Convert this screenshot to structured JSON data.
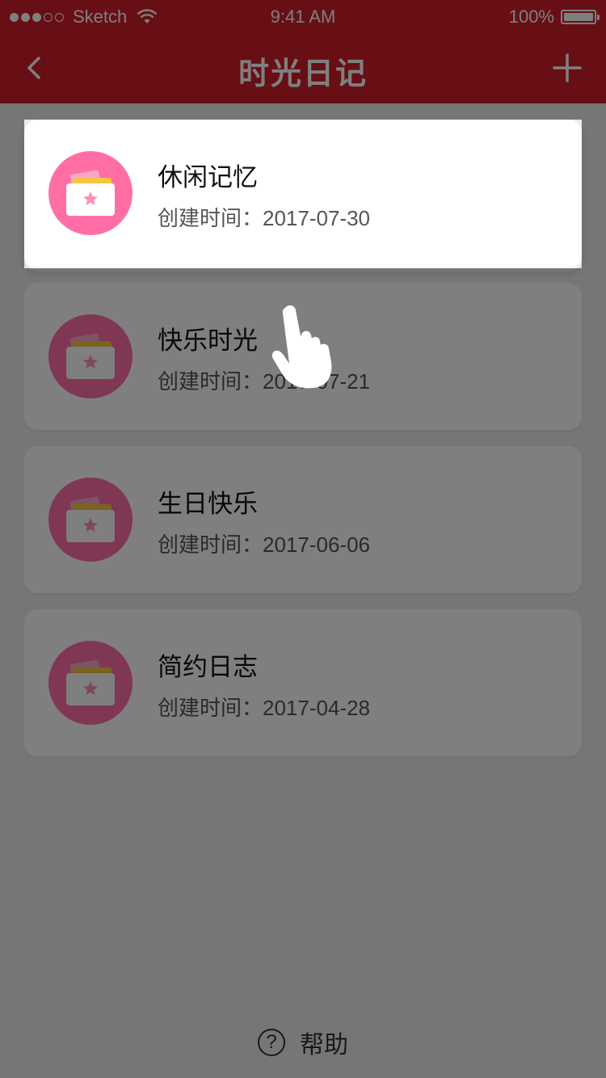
{
  "status_bar": {
    "carrier": "Sketch",
    "time": "9:41 AM",
    "battery": "100%",
    "battery_level": 1.0
  },
  "nav": {
    "title": "时光日记",
    "back_icon": "chevron-left-icon",
    "add_icon": "plus-icon"
  },
  "diaries": [
    {
      "title": "休闲记忆",
      "created_label": "创建时间：",
      "date": "2017-07-30"
    },
    {
      "title": "快乐时光",
      "created_label": "创建时间：",
      "date": "2017-07-21"
    },
    {
      "title": "生日快乐",
      "created_label": "创建时间：",
      "date": "2017-06-06"
    },
    {
      "title": "简约日志",
      "created_label": "创建时间：",
      "date": "2017-04-28"
    }
  ],
  "help": {
    "label": "帮助",
    "icon": "?"
  },
  "colors": {
    "brand_red": "#cf1f2a",
    "icon_pink": "#ff6fa6",
    "background": "#ededed"
  }
}
